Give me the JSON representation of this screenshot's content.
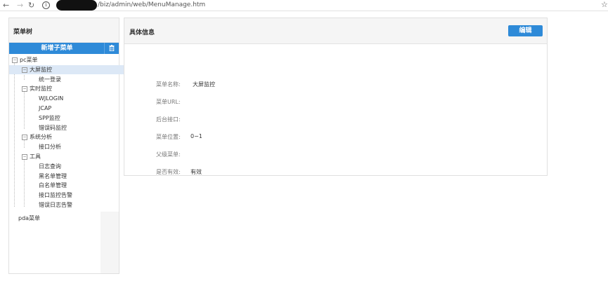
{
  "browser": {
    "url": "/biz/admin/web/MenuManage.htm"
  },
  "left": {
    "title": "菜单树",
    "add_label": "新增子菜单",
    "tree": [
      {
        "label": "pc菜单",
        "toggle": "−",
        "level": 0,
        "selected": false
      },
      {
        "label": "大屏监控",
        "toggle": "−",
        "level": 1,
        "selected": true
      },
      {
        "label": "统一登录",
        "toggle": "",
        "level": 2,
        "selected": false
      },
      {
        "label": "实时监控",
        "toggle": "−",
        "level": 1,
        "selected": false
      },
      {
        "label": "WJLOGIN",
        "toggle": "",
        "level": 2,
        "selected": false
      },
      {
        "label": "JCAP",
        "toggle": "",
        "level": 2,
        "selected": false
      },
      {
        "label": "SPP监控",
        "toggle": "",
        "level": 2,
        "selected": false
      },
      {
        "label": "错误码监控",
        "toggle": "",
        "level": 2,
        "selected": false
      },
      {
        "label": "系统分析",
        "toggle": "−",
        "level": 1,
        "selected": false
      },
      {
        "label": "接口分析",
        "toggle": "",
        "level": 2,
        "selected": false
      },
      {
        "label": "工具",
        "toggle": "−",
        "level": 1,
        "selected": false
      },
      {
        "label": "日志查询",
        "toggle": "",
        "level": 2,
        "selected": false
      },
      {
        "label": "黑名单管理",
        "toggle": "",
        "level": 2,
        "selected": false
      },
      {
        "label": "白名单管理",
        "toggle": "",
        "level": 2,
        "selected": false
      },
      {
        "label": "接口监控告警",
        "toggle": "",
        "level": 2,
        "selected": false
      },
      {
        "label": "错误日志告警",
        "toggle": "",
        "level": 2,
        "selected": false
      }
    ],
    "pda_label": "pda菜单"
  },
  "right": {
    "title": "具体信息",
    "edit_label": "编辑",
    "fields": [
      {
        "label": "菜单名称:",
        "value": "大屏监控"
      },
      {
        "label": "菜单URL:",
        "value": ""
      },
      {
        "label": "后台接口:",
        "value": ""
      },
      {
        "label": "菜单位置:",
        "value": "0−1"
      },
      {
        "label": "父级菜单:",
        "value": ""
      },
      {
        "label": "是否有效:",
        "value": "有效"
      }
    ]
  },
  "colors": {
    "accent": "#2e8ad8",
    "selected_row": "#dce8f6"
  }
}
